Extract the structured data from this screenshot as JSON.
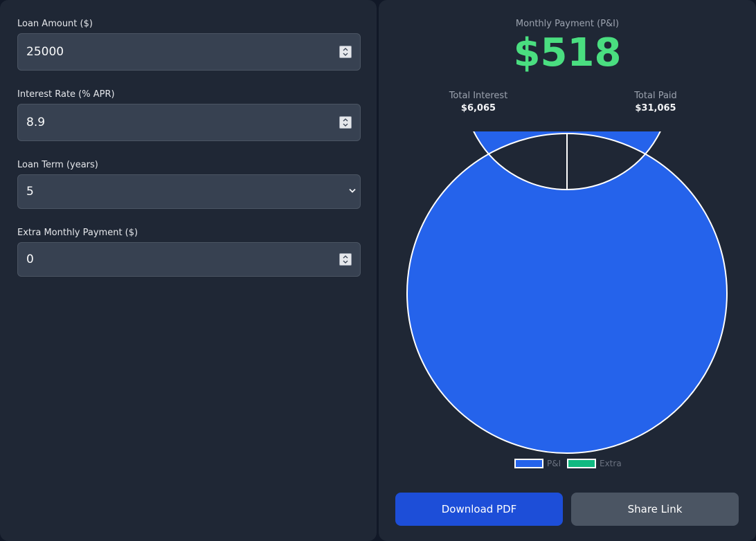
{
  "form": {
    "loan_amount": {
      "label": "Loan Amount ($)",
      "value": "25000"
    },
    "interest_rate": {
      "label": "Interest Rate (% APR)",
      "value": "8.9"
    },
    "loan_term": {
      "label": "Loan Term (years)",
      "value": "5"
    },
    "extra_payment": {
      "label": "Extra Monthly Payment ($)",
      "value": "0"
    }
  },
  "results": {
    "monthly_label": "Monthly Payment (P&I)",
    "monthly_value": "$518",
    "total_interest_label": "Total Interest",
    "total_interest_value": "$6,065",
    "total_paid_label": "Total Paid",
    "total_paid_value": "$31,065"
  },
  "chart_data": {
    "type": "pie",
    "categories": [
      "P&I",
      "Extra"
    ],
    "values": [
      518,
      0
    ],
    "colors": [
      "#2563eb",
      "#10b981"
    ],
    "legend": "bottom"
  },
  "actions": {
    "download_label": "Download PDF",
    "share_label": "Share Link"
  },
  "icons": {
    "spinner": "spinner-arrows-icon",
    "dropdown": "chevron-down-icon"
  }
}
